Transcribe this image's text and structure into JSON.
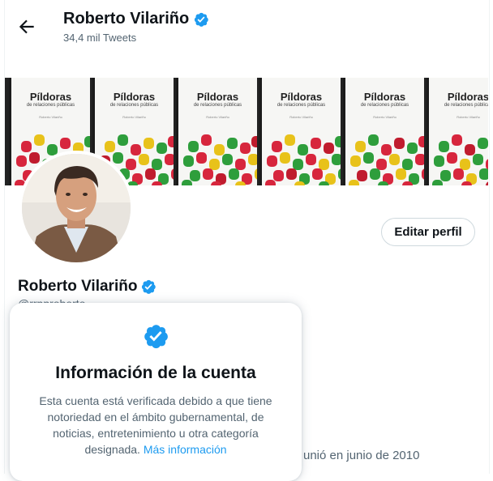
{
  "header": {
    "name": "Roberto Vilariño",
    "tweet_count": "34,4 mil Tweets"
  },
  "banner": {
    "book_title": "Píldoras",
    "book_subtitle": "de relaciones públicas",
    "book_author": "Roberto Vilariño",
    "tile_count": 6
  },
  "profile": {
    "name": "Roberto Vilariño",
    "handle": "@rrpproberto",
    "edit_label": "Editar perfil",
    "joined": "unió en junio de 2010"
  },
  "popover": {
    "title": "Información de la cuenta",
    "body": "Esta cuenta está verificada debido a que tiene notoriedad en el ámbito gubernamental, de noticias, entretenimiento u otra categoría designada.",
    "link": "Más información"
  },
  "colors": {
    "verified": "#1d9bf0",
    "text_secondary": "#536471"
  },
  "icons": {
    "back": "arrow-left-icon",
    "verified": "verified-badge-icon"
  }
}
